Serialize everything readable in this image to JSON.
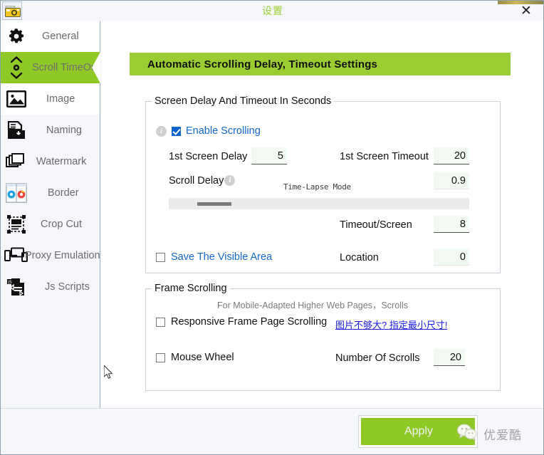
{
  "window": {
    "title": "设置",
    "close_label": "✕",
    "app_icon": "camera-icon"
  },
  "sidebar": {
    "items": [
      {
        "label": "General",
        "icon": "gear-icon",
        "active": false
      },
      {
        "label": "Scroll TimeOut",
        "icon": "scroll-arrows-icon",
        "active": true
      },
      {
        "label": "Image",
        "icon": "picture-icon",
        "active": false
      },
      {
        "label": "Naming",
        "icon": "save-file-icon",
        "active": false
      },
      {
        "label": "Watermark",
        "icon": "layers-icon",
        "active": false
      },
      {
        "label": "Border",
        "icon": "browsers-icon",
        "active": false
      },
      {
        "label": "Crop Cut",
        "icon": "crop-icon",
        "active": false
      },
      {
        "label": "Proxy Emulation",
        "icon": "devices-icon",
        "active": false
      },
      {
        "label": "Js Scripts",
        "icon": "script-file-icon",
        "active": false
      }
    ]
  },
  "main": {
    "banner_title": "Automatic Scrolling Delay, Timeout Settings",
    "group1": {
      "legend": "Screen Delay And Timeout In Seconds",
      "enable_scrolling": {
        "label": "Enable Scrolling",
        "checked": true,
        "info_icon": "info-icon"
      },
      "first_screen_delay": {
        "label": "1st Screen Delay",
        "value": "5"
      },
      "first_screen_timeout": {
        "label": "1st Screen Timeout",
        "value": "20"
      },
      "scroll_delay": {
        "label": "Scroll Delay",
        "info_icon": "info-icon"
      },
      "time_lapse_mode": {
        "label": "Time-Lapse Mode"
      },
      "scroll_delay_value": "0.9",
      "slider": {
        "position_pct": 14
      },
      "timeout_per_screen": {
        "label": "Timeout/Screen",
        "value": "8"
      },
      "location": {
        "label": "Location",
        "value": "0"
      },
      "save_visible_area": {
        "label": "Save The Visible Area",
        "checked": false
      }
    },
    "group2": {
      "legend": "Frame Scrolling",
      "hint": "For Mobile-Adapted Higher Web Pages，Scrolls",
      "responsive_frame": {
        "label": "Responsive Frame Page Scrolling",
        "checked": false
      },
      "link": "图片不够大? 指定最小尺寸!",
      "mouse_wheel": {
        "label": "Mouse Wheel",
        "checked": false
      },
      "number_of_scrolls": {
        "label": "Number Of Scrolls",
        "value": "20"
      }
    }
  },
  "footer": {
    "apply_label": "Apply",
    "watermark_text": "优爱酷",
    "watermark_icon": "wechat-icon"
  },
  "colors": {
    "accent_green": "#9acd32",
    "tab_green": "#8fc927",
    "link_blue": "#1569c7",
    "cn_link_blue": "#1a1ae0",
    "checkbox_blue": "#0b63ce"
  }
}
